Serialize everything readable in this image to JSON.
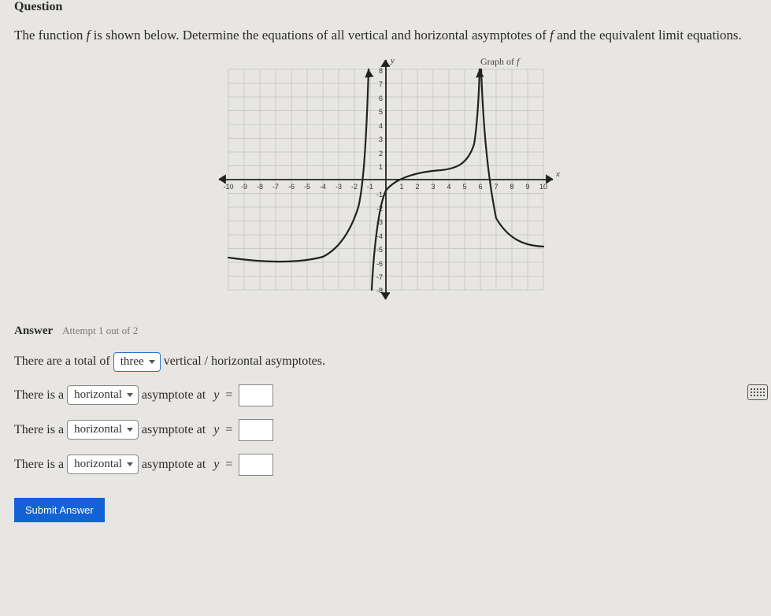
{
  "header": {
    "title": "Question"
  },
  "prompt": {
    "pre": "The function ",
    "f1": "f",
    "mid1": " is shown below. Determine the equations of all vertical and horizontal asymptotes of ",
    "f2": "f",
    "mid2": " and the equivalent limit equations."
  },
  "graph": {
    "title": "Graph of f",
    "y_label": "y",
    "x_label": "x",
    "x_ticks": [
      "-10",
      "-9",
      "-8",
      "-7",
      "-6",
      "-5",
      "-4",
      "-3",
      "-2",
      "-1",
      "1",
      "2",
      "3",
      "4",
      "5",
      "6",
      "7",
      "8",
      "9",
      "10"
    ],
    "y_ticks_pos": [
      "8",
      "7",
      "6",
      "5",
      "4",
      "3",
      "2",
      "1"
    ],
    "y_ticks_neg": [
      "-1",
      "-2",
      "-3",
      "-4",
      "-5",
      "-6",
      "-7",
      "-8"
    ]
  },
  "answer": {
    "label": "Answer",
    "attempt": "Attempt 1 out of 2",
    "total_line_pre": "There are a total of",
    "total_select": "three",
    "total_line_post": "vertical / horizontal asymptotes.",
    "rows": [
      {
        "pre": "There is a",
        "sel": "horizontal",
        "mid": "asymptote at",
        "var": "y",
        "eq": "="
      },
      {
        "pre": "There is a",
        "sel": "horizontal",
        "mid": "asymptote at",
        "var": "y",
        "eq": "="
      },
      {
        "pre": "There is a",
        "sel": "horizontal",
        "mid": "asymptote at",
        "var": "y",
        "eq": "="
      }
    ],
    "submit": "Submit Answer"
  },
  "chart_data": {
    "type": "line",
    "title": "Graph of f",
    "xlabel": "x",
    "ylabel": "y",
    "xlim": [
      -10,
      10
    ],
    "ylim": [
      -8,
      8
    ],
    "vertical_asymptotes": [
      -1,
      6
    ],
    "horizontal_asymptotes": [
      -5
    ],
    "series": [
      {
        "name": "f left branch",
        "x": [
          -10,
          -9,
          -8,
          -7,
          -6,
          -5,
          -4,
          -3,
          -2.5,
          -2,
          -1.7,
          -1.4,
          -1.2,
          -1.05
        ],
        "y": [
          -5.7,
          -5.8,
          -5.9,
          -6.0,
          -6.0,
          -5.9,
          -5.6,
          -4.8,
          -3.8,
          -2.0,
          0.5,
          3.0,
          5.5,
          8.0
        ]
      },
      {
        "name": "f middle branch",
        "x": [
          -0.95,
          -0.8,
          -0.6,
          -0.3,
          0,
          0.5,
          1,
          2,
          3,
          4,
          5,
          5.4,
          5.7,
          5.85,
          5.95
        ],
        "y": [
          -8.0,
          -6.0,
          -4.0,
          -2.0,
          -0.8,
          0.0,
          0.4,
          0.7,
          0.7,
          0.9,
          1.5,
          2.5,
          4.0,
          6.0,
          8.0
        ]
      },
      {
        "name": "f right branch",
        "x": [
          6.05,
          6.15,
          6.3,
          6.6,
          7,
          7.5,
          8,
          9,
          10
        ],
        "y": [
          8.0,
          5.0,
          2.0,
          -1.0,
          -2.8,
          -3.8,
          -4.3,
          -4.7,
          -4.85
        ]
      }
    ]
  }
}
